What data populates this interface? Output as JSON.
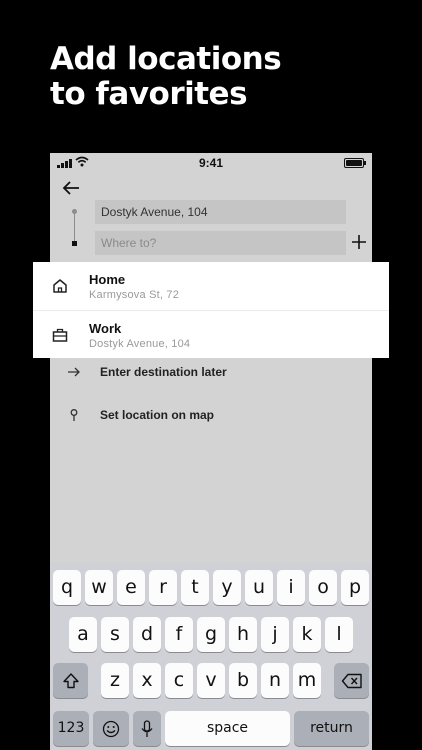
{
  "headline": {
    "line1": "Add locations",
    "line2": "to favorites"
  },
  "status_bar": {
    "time": "9:41"
  },
  "route": {
    "pickup_value": "Dostyk Avenue, 104",
    "destination_placeholder": "Where to?"
  },
  "favorites": [
    {
      "title": "Home",
      "address": "Karmysova St, 72",
      "icon": "home-icon"
    },
    {
      "title": "Work",
      "address": "Dostyk Avenue, 104",
      "icon": "briefcase-icon"
    }
  ],
  "options": [
    {
      "label": "Enter destination later",
      "icon": "arrow-right-icon"
    },
    {
      "label": "Set location on map",
      "icon": "map-pin-icon"
    }
  ],
  "keyboard": {
    "row1": [
      "q",
      "w",
      "e",
      "r",
      "t",
      "y",
      "u",
      "i",
      "o",
      "p"
    ],
    "row2": [
      "a",
      "s",
      "d",
      "f",
      "g",
      "h",
      "j",
      "k",
      "l"
    ],
    "row3": [
      "z",
      "x",
      "c",
      "v",
      "b",
      "n",
      "m"
    ],
    "numbers_label": "123",
    "space_label": "space",
    "return_label": "return"
  }
}
